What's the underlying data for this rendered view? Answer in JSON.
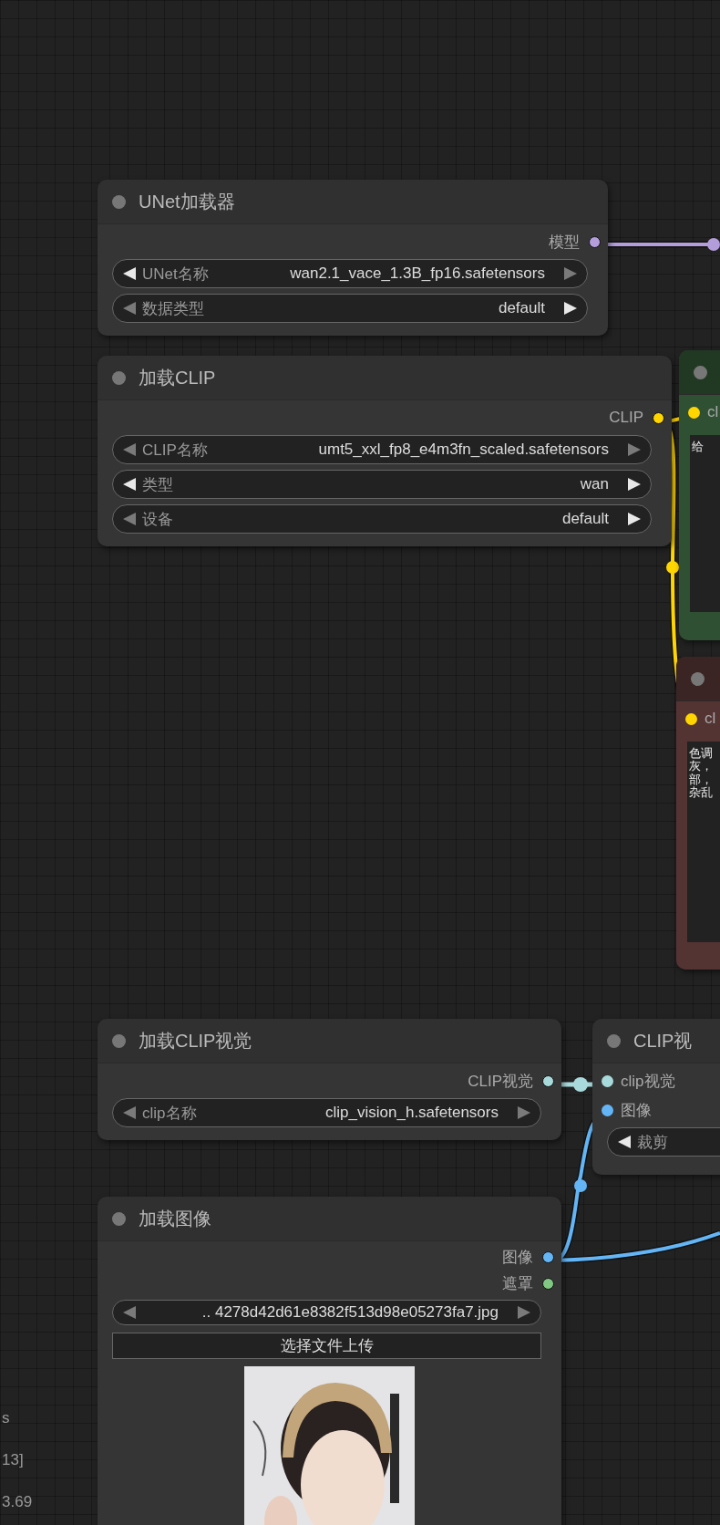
{
  "nodes": [
    {
      "title": "UNet加载器",
      "outputs": [
        {
          "label": "模型",
          "color": "#b39ddb"
        }
      ],
      "widgets": [
        {
          "kind": "combo",
          "label": "UNet名称",
          "value": "wan2.1_vace_1.3B_fp16.safetensors",
          "prev_enabled": true,
          "next_enabled": false
        },
        {
          "kind": "combo",
          "label": "数据类型",
          "value": "default",
          "prev_enabled": false,
          "next_enabled": true
        }
      ]
    },
    {
      "title": "加载CLIP",
      "outputs": [
        {
          "label": "CLIP",
          "color": "#ffd500"
        }
      ],
      "widgets": [
        {
          "kind": "combo",
          "label": "CLIP名称",
          "value": "umt5_xxl_fp8_e4m3fn_scaled.safetensors",
          "prev_enabled": false,
          "next_enabled": false
        },
        {
          "kind": "combo",
          "label": "类型",
          "value": "wan",
          "prev_enabled": true,
          "next_enabled": true
        },
        {
          "kind": "combo",
          "label": "设备",
          "value": "default",
          "prev_enabled": false,
          "next_enabled": true
        }
      ]
    },
    {
      "color": "#2f5032",
      "inputs": [
        {
          "label": "cl",
          "color": "#ffd500"
        }
      ],
      "widgets": [
        {
          "kind": "text",
          "value": "给"
        }
      ]
    },
    {
      "color": "#543333",
      "inputs": [
        {
          "label": "cl",
          "color": "#ffd500"
        }
      ],
      "widgets": [
        {
          "kind": "text",
          "lines": [
            "色调",
            "灰，",
            "部，",
            "杂乱"
          ]
        }
      ]
    },
    {
      "title": "加载CLIP视觉",
      "outputs": [
        {
          "label": "CLIP视觉",
          "color": "#a8dadc"
        }
      ],
      "widgets": [
        {
          "kind": "combo",
          "label": "clip名称",
          "value": "clip_vision_h.safetensors",
          "prev_enabled": false,
          "next_enabled": false
        }
      ]
    },
    {
      "title": "CLIP视",
      "inputs": [
        {
          "label": "clip视觉",
          "color": "#a8dadc"
        },
        {
          "label": "图像",
          "color": "#64b5f6"
        }
      ],
      "widgets": [
        {
          "kind": "combo",
          "label": "裁剪",
          "prev_enabled": true
        }
      ]
    },
    {
      "title": "加载图像",
      "outputs": [
        {
          "label": "图像",
          "color": "#64b5f6"
        },
        {
          "label": "遮罩",
          "color": "#81c784"
        }
      ],
      "widgets": [
        {
          "kind": "combo",
          "value": ".. 4278d42d61e8382f513d98e05273fa7.jpg",
          "prev_enabled": false,
          "next_enabled": false
        },
        {
          "kind": "button",
          "label": "选择文件上传"
        },
        {
          "kind": "picture"
        }
      ]
    }
  ],
  "side_texts": [
    "s",
    "13]",
    "3.69"
  ]
}
